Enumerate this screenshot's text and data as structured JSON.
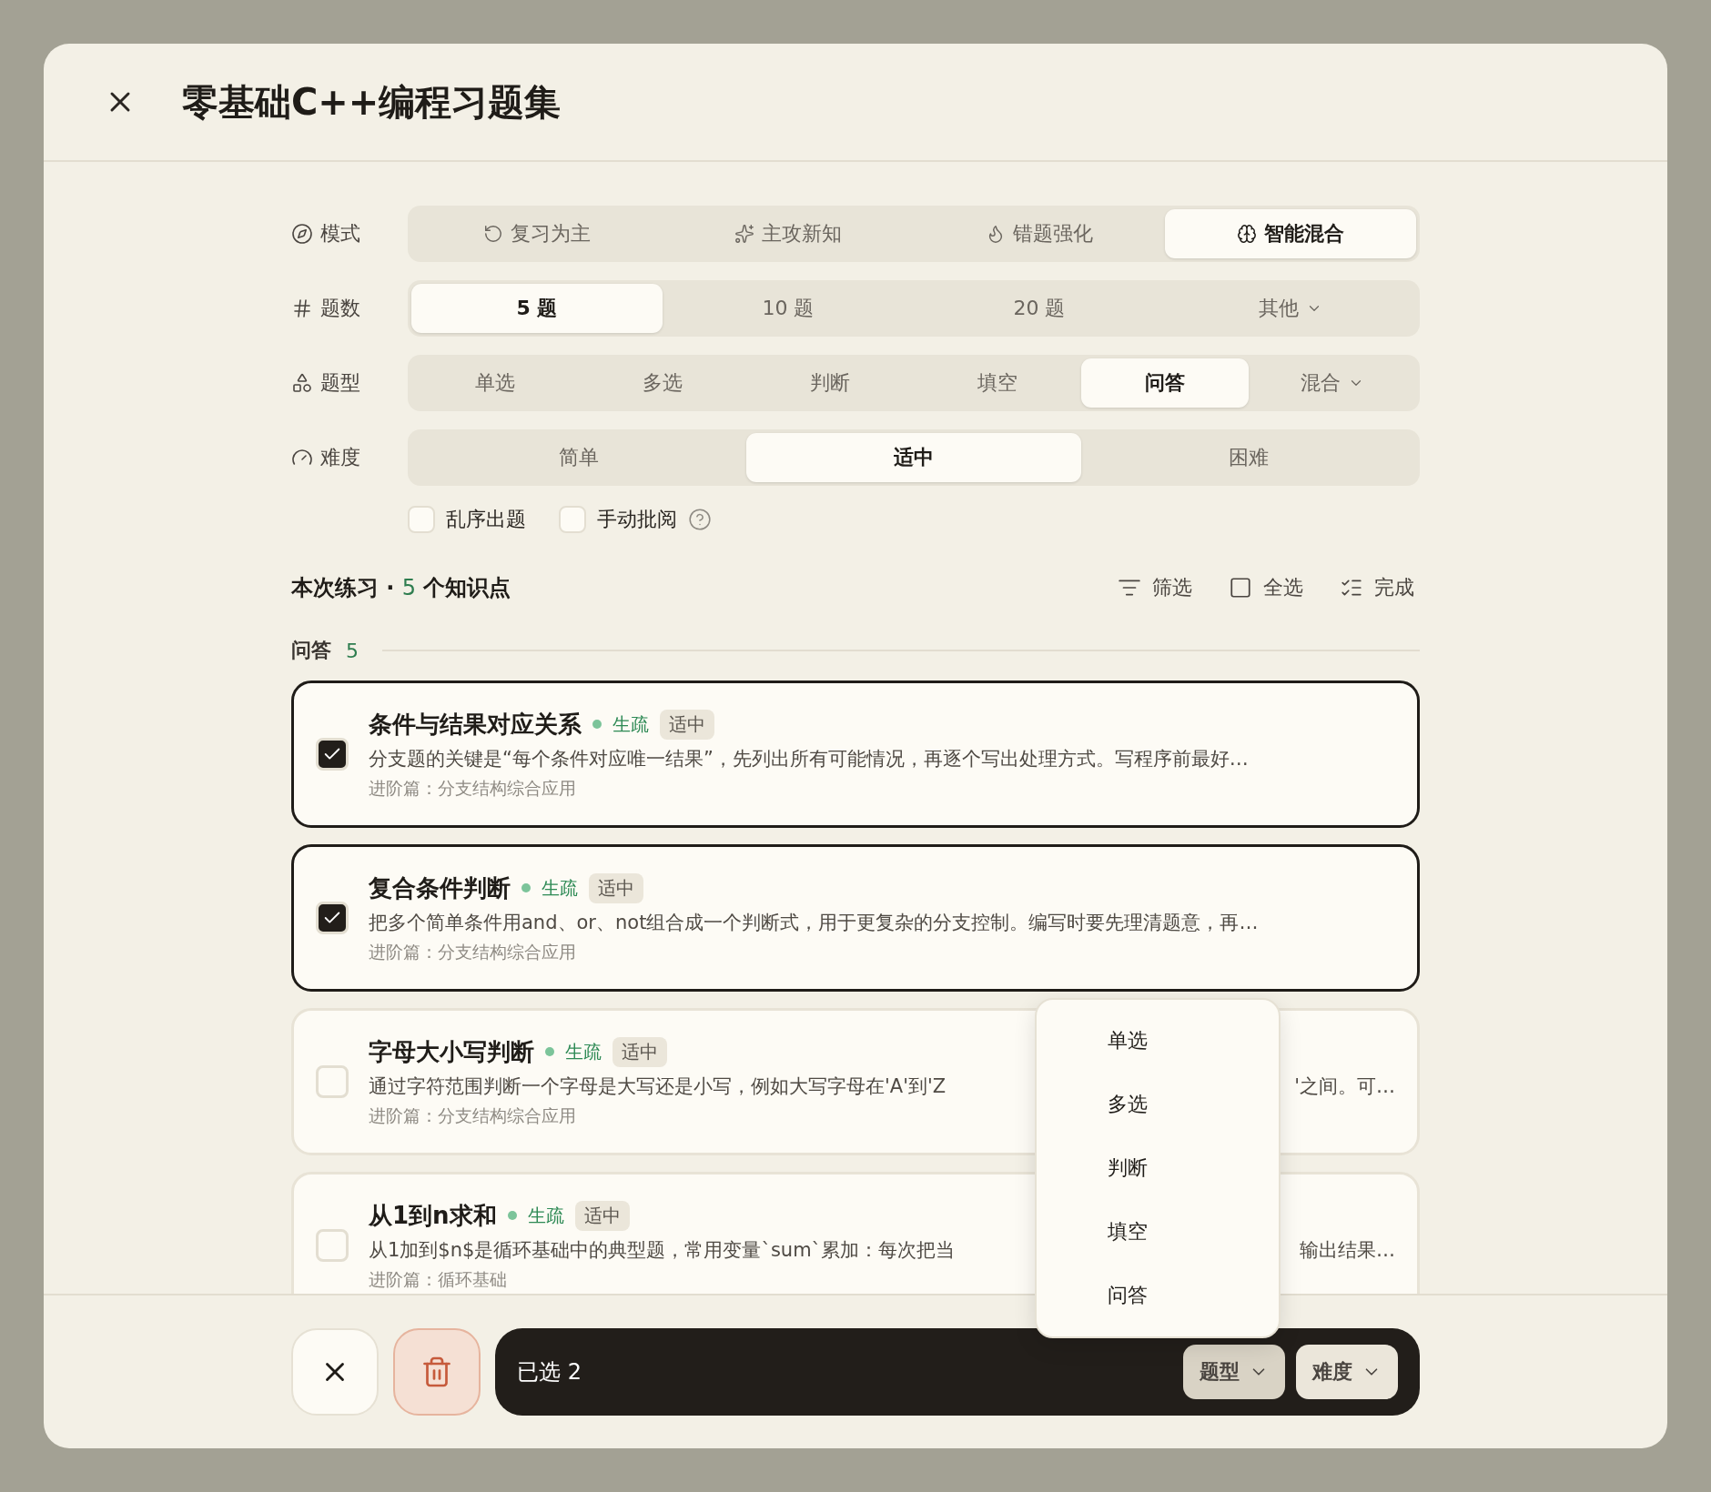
{
  "window": {
    "title": "零基础C++编程习题集"
  },
  "settings": [
    {
      "label": "模式",
      "kind": "mode",
      "options": [
        {
          "label": "复习为主",
          "selected": false,
          "menu": false
        },
        {
          "label": "主攻新知",
          "selected": false,
          "menu": false
        },
        {
          "label": "错题强化",
          "selected": false,
          "menu": false
        },
        {
          "label": "智能混合",
          "selected": true,
          "menu": false
        }
      ]
    },
    {
      "label": "题数",
      "kind": "count",
      "options": [
        {
          "label": "5 题",
          "selected": true,
          "menu": false
        },
        {
          "label": "10 题",
          "selected": false,
          "menu": false
        },
        {
          "label": "20 题",
          "selected": false,
          "menu": false
        },
        {
          "label": "其他",
          "selected": false,
          "menu": true
        }
      ]
    },
    {
      "label": "题型",
      "kind": "type",
      "options": [
        {
          "label": "单选",
          "selected": false,
          "menu": false
        },
        {
          "label": "多选",
          "selected": false,
          "menu": false
        },
        {
          "label": "判断",
          "selected": false,
          "menu": false
        },
        {
          "label": "填空",
          "selected": false,
          "menu": false
        },
        {
          "label": "问答",
          "selected": true,
          "menu": false
        },
        {
          "label": "混合",
          "selected": false,
          "menu": true
        }
      ]
    },
    {
      "label": "难度",
      "kind": "difficulty",
      "options": [
        {
          "label": "简单",
          "selected": false,
          "menu": false
        },
        {
          "label": "适中",
          "selected": true,
          "menu": false
        },
        {
          "label": "困难",
          "selected": false,
          "menu": false
        }
      ]
    }
  ],
  "toggles": [
    {
      "label": "乱序出题",
      "checked": false
    },
    {
      "label": "手动批阅",
      "checked": false,
      "help": true
    }
  ],
  "summary": {
    "prefix": "本次练习 · ",
    "count": "5",
    "suffix": " 个知识点"
  },
  "toolbar": [
    {
      "kind": "filter",
      "label": "筛选"
    },
    {
      "kind": "select_all",
      "label": "全选"
    },
    {
      "kind": "done",
      "label": "完成"
    }
  ],
  "section": {
    "label": "问答",
    "count": "5"
  },
  "cards": [
    {
      "title": "条件与结果对应关系",
      "status": "生疏",
      "tag": "适中",
      "checked": true,
      "description": [
        "分支题的关键是“每个条件对应唯一结果”，先列出所有可能情况，再逐个写出处理方式。写程序前最好…"
      ],
      "path": "进阶篇：分支结构综合应用"
    },
    {
      "title": "复合条件判断",
      "status": "生疏",
      "tag": "适中",
      "checked": true,
      "description": [
        "把多个简单条件用and、or、not组合成一个判断式，用于更复杂的分支控制。编写时要先理清题意，再…"
      ],
      "path": "进阶篇：分支结构综合应用"
    },
    {
      "title": "字母大小写判断",
      "status": "生疏",
      "tag": "适中",
      "checked": false,
      "description": [
        "通过字符范围判断一个字母是大写还是小写，例如大写字母在'A'到'Z",
        "'之间。可…"
      ],
      "path": "进阶篇：分支结构综合应用"
    },
    {
      "title": "从1到n求和",
      "status": "生疏",
      "tag": "适中",
      "checked": false,
      "description": [
        "从1加到$n$是循环基础中的典型题，常用变量`sum`累加：每次把当",
        "输出结果…"
      ],
      "path": "进阶篇：循环基础"
    }
  ],
  "footer": {
    "selected_label": "已选 2",
    "filters": [
      {
        "label": "题型",
        "open": true
      },
      {
        "label": "难度",
        "open": false
      }
    ]
  },
  "menu": {
    "items": [
      "单选",
      "多选",
      "判断",
      "填空",
      "问答"
    ]
  }
}
